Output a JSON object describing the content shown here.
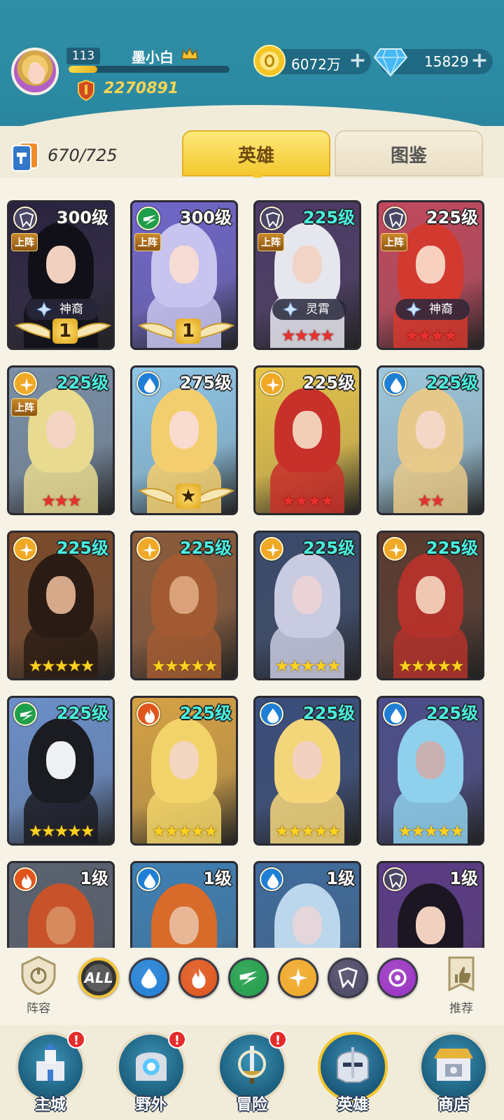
{
  "player": {
    "level": "113",
    "name": "墨小白",
    "xp_fraction": 0.18,
    "power": "2270891"
  },
  "resources": {
    "gold": "6072万",
    "diamonds": "15829"
  },
  "collection": {
    "count": "670/725"
  },
  "tabs": [
    "英雄",
    "图鉴"
  ],
  "active_tab": "英雄",
  "heroes": [
    {
      "faction": "dark",
      "level": "300级",
      "level_color": "white",
      "deployed": "上阵",
      "tag": "神裔",
      "tag_icon": "angel-icon",
      "badge": "1",
      "stars": "",
      "star_color": "none",
      "palette": [
        "#2a2340",
        "#111018",
        "#f1d0c0"
      ]
    },
    {
      "faction": "wind",
      "level": "300级",
      "level_color": "white",
      "deployed": "上阵",
      "tag": "",
      "tag_icon": "",
      "badge": "1",
      "stars": "",
      "star_color": "none",
      "palette": [
        "#6f66c9",
        "#c8c4ef",
        "#f6dcd5"
      ]
    },
    {
      "faction": "dark",
      "level": "225级",
      "level_color": "teal",
      "deployed": "上阵",
      "tag": "灵霄",
      "tag_icon": "cloud-icon",
      "badge": "",
      "stars": "★★★★",
      "star_color": "red",
      "palette": [
        "#4b3a66",
        "#e6e6ee",
        "#f1d4c6"
      ]
    },
    {
      "faction": "dark",
      "level": "225级",
      "level_color": "white",
      "deployed": "上阵",
      "tag": "神裔",
      "tag_icon": "angel-icon",
      "badge": "",
      "stars": "★★★★",
      "star_color": "red",
      "palette": [
        "#c2495e",
        "#d33a2f",
        "#f7d0c0"
      ]
    },
    {
      "faction": "light",
      "level": "225级",
      "level_color": "teal",
      "deployed": "上阵",
      "tag": "",
      "tag_icon": "",
      "badge": "",
      "stars": "★★★",
      "star_color": "red",
      "palette": [
        "#7a8fa7",
        "#e8db90",
        "#f4d4c2"
      ]
    },
    {
      "faction": "water",
      "level": "275级",
      "level_color": "white",
      "deployed": "",
      "tag": "",
      "tag_icon": "",
      "badge": "★",
      "stars": "",
      "star_color": "none",
      "palette": [
        "#8fc6e6",
        "#f3ce6e",
        "#fadbcf"
      ]
    },
    {
      "faction": "light",
      "level": "225级",
      "level_color": "white",
      "deployed": "",
      "tag": "",
      "tag_icon": "",
      "badge": "",
      "stars": "★★★★",
      "star_color": "red",
      "palette": [
        "#e6c44b",
        "#c8302a",
        "#f2ceb8"
      ]
    },
    {
      "faction": "water",
      "level": "225级",
      "level_color": "teal",
      "deployed": "",
      "tag": "",
      "tag_icon": "",
      "badge": "",
      "stars": "★★",
      "star_color": "red",
      "palette": [
        "#9fc7dc",
        "#e6c98a",
        "#f4d7c6"
      ]
    },
    {
      "faction": "light",
      "level": "225级",
      "level_color": "teal",
      "deployed": "",
      "tag": "",
      "tag_icon": "",
      "badge": "",
      "stars": "★★★★★",
      "star_color": "gold",
      "palette": [
        "#7b4a2a",
        "#2a1c14",
        "#d6a98a"
      ]
    },
    {
      "faction": "light",
      "level": "225级",
      "level_color": "teal",
      "deployed": "",
      "tag": "",
      "tag_icon": "",
      "badge": "",
      "stars": "★★★★★",
      "star_color": "gold",
      "palette": [
        "#8a5a3a",
        "#a25a32",
        "#d9a27a"
      ]
    },
    {
      "faction": "light",
      "level": "225级",
      "level_color": "teal",
      "deployed": "",
      "tag": "",
      "tag_icon": "",
      "badge": "",
      "stars": "★★★★★",
      "star_color": "gold",
      "palette": [
        "#3a4a6c",
        "#c9cbe0",
        "#e9d3d6"
      ]
    },
    {
      "faction": "light",
      "level": "225级",
      "level_color": "teal",
      "deployed": "",
      "tag": "",
      "tag_icon": "",
      "badge": "",
      "stars": "★★★★★",
      "star_color": "gold",
      "palette": [
        "#5a3a2e",
        "#b2322c",
        "#efc7b2"
      ]
    },
    {
      "faction": "wind",
      "level": "225级",
      "level_color": "teal",
      "deployed": "",
      "tag": "",
      "tag_icon": "",
      "badge": "",
      "stars": "★★★★★",
      "star_color": "gold",
      "palette": [
        "#6b8fc9",
        "#1b1b22",
        "#eef0f4"
      ]
    },
    {
      "faction": "fire",
      "level": "225级",
      "level_color": "teal",
      "deployed": "",
      "tag": "",
      "tag_icon": "",
      "badge": "",
      "stars": "★★★★★",
      "star_color": "gold",
      "palette": [
        "#d6a244",
        "#f1d36a",
        "#f3d6c0"
      ]
    },
    {
      "faction": "water",
      "level": "225级",
      "level_color": "teal",
      "deployed": "",
      "tag": "",
      "tag_icon": "",
      "badge": "",
      "stars": "★★★★★",
      "star_color": "gold",
      "palette": [
        "#3a4e7c",
        "#f4d67a",
        "#f3d1c0"
      ]
    },
    {
      "faction": "water",
      "level": "225级",
      "level_color": "teal",
      "deployed": "",
      "tag": "",
      "tag_icon": "",
      "badge": "",
      "stars": "★★★★★",
      "star_color": "gold",
      "palette": [
        "#4c4d8a",
        "#8fd0ec",
        "#c9b1b1"
      ]
    },
    {
      "faction": "fire",
      "level": "1级",
      "level_color": "white",
      "deployed": "",
      "tag": "",
      "tag_icon": "",
      "badge": "",
      "stars": "",
      "star_color": "none",
      "palette": [
        "#5a6270",
        "#c8532a",
        "#d78a5e"
      ]
    },
    {
      "faction": "water",
      "level": "1级",
      "level_color": "white",
      "deployed": "",
      "tag": "",
      "tag_icon": "",
      "badge": "",
      "stars": "",
      "star_color": "none",
      "palette": [
        "#3f7fb2",
        "#d86a2a",
        "#e8b796"
      ]
    },
    {
      "faction": "water",
      "level": "1级",
      "level_color": "white",
      "deployed": "",
      "tag": "",
      "tag_icon": "",
      "badge": "",
      "stars": "",
      "star_color": "none",
      "palette": [
        "#3f6b9c",
        "#bcd6ec",
        "#e4d6da"
      ]
    },
    {
      "faction": "dark",
      "level": "1级",
      "level_color": "white",
      "deployed": "",
      "tag": "",
      "tag_icon": "",
      "badge": "",
      "stars": "",
      "star_color": "none",
      "palette": [
        "#5b3a86",
        "#1c1622",
        "#f1d0c0"
      ]
    }
  ],
  "faction_colors": {
    "water": "#1f7fd6",
    "fire": "#e0551c",
    "wind": "#1f9e4a",
    "light": "#f0a827",
    "dark": "#4a4766",
    "chaos": "#9a32c4"
  },
  "filters": {
    "left_label": "阵容",
    "right_label": "推荐",
    "all_label": "ALL",
    "factions": [
      "water",
      "fire",
      "wind",
      "light",
      "dark",
      "chaos"
    ]
  },
  "nav": [
    {
      "label": "主城",
      "icon": "castle-icon",
      "alert": "!"
    },
    {
      "label": "野外",
      "icon": "portal-icon",
      "alert": "!"
    },
    {
      "label": "冒险",
      "icon": "sword-icon",
      "alert": "!"
    },
    {
      "label": "英雄",
      "icon": "helmet-icon",
      "alert": ""
    },
    {
      "label": "商店",
      "icon": "shop-icon",
      "alert": ""
    }
  ],
  "active_nav": "英雄"
}
